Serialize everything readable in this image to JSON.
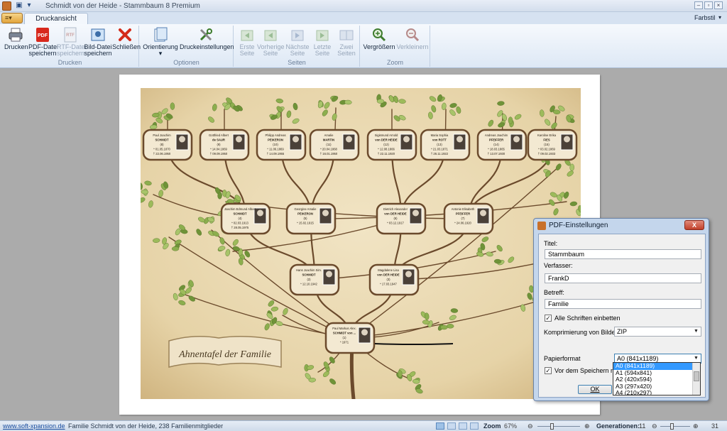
{
  "window": {
    "title": "Schmidt von der Heide - Stammbaum 8 Premium",
    "theme_label": "Farbstil"
  },
  "tabs": {
    "active": "Druckansicht"
  },
  "ribbon": {
    "groups": {
      "druck": "Drucken",
      "optionen": "Optionen",
      "seiten": "Seiten",
      "zoom": "Zoom"
    },
    "buttons": {
      "print": [
        "Drucken",
        ""
      ],
      "pdf": [
        "PDF-Datei",
        "speichern"
      ],
      "rtf": [
        "RTF-Datei",
        "speichern"
      ],
      "image": [
        "Bild-Datei",
        "speichern"
      ],
      "close": [
        "Schließen",
        ""
      ],
      "orientation": [
        "Orientierung",
        ""
      ],
      "print_settings": [
        "Druckeinstellungen",
        ""
      ],
      "first": [
        "Erste",
        "Seite"
      ],
      "prev": [
        "Vorherige",
        "Seite"
      ],
      "next": [
        "Nächste",
        "Seite"
      ],
      "last": [
        "Letzte",
        "Seite"
      ],
      "two": [
        "Zwei",
        "Seiten"
      ],
      "zoom_in": [
        "Vergrößern",
        ""
      ],
      "zoom_out": [
        "Verkleinern",
        ""
      ]
    }
  },
  "tree": {
    "banner": "Ahnentafel der Familie",
    "people": [
      [
        "Paul Joachim",
        "SCHMIDT",
        "(8)",
        "* 01.05.1870",
        "† 22.06.1950"
      ],
      [
        "Gottfried Albert",
        "de SAUR",
        "(9)",
        "* 14.04.1869",
        "† 09.09.1950"
      ],
      [
        "Philipp Andreas",
        "PEIKERON",
        "(10)",
        "* 11.06.1869",
        "† 14.09.1955"
      ],
      [
        "Amalie",
        "MARTIN",
        "(11)",
        "* 20.04.1868",
        "† 16.01.1950"
      ],
      [
        "Sigismund Arnold",
        "von DER HEIDE",
        "(12)",
        "* 12.08.1866",
        "† 22.11.1920"
      ],
      [
        "Maria Sophia",
        "von ROTT",
        "(13)",
        "* 21.03.1871",
        "† 26.11.1922"
      ],
      [
        "Andreas Joachim",
        "PFEIFFER",
        "(14)",
        "* 18.03.1865",
        "† 13.07.1930"
      ],
      [
        "Karoline Erika",
        "FIES",
        "(15)",
        "* 03.02.1869",
        "† 09.02.1933"
      ],
      [
        "Joachim Edmund Albert",
        "SCHMIDT",
        "(4)",
        "* 02.03.1913",
        "† 28.05.1975"
      ],
      [
        "Georgine Amalie",
        "PEIKERON",
        "(5)",
        "* 15.02.1915",
        ""
      ],
      [
        "Dietrich Alexander",
        "von DER HEIDE",
        "(6)",
        "* 03.12.1917",
        ""
      ],
      [
        "Antonie Elisabeth",
        "PFEIFFER",
        "(7)",
        "* 24.06.1920",
        ""
      ],
      [
        "Hans Joachim Sim.",
        "SCHMIDT",
        "(2)",
        "* 12.10.1942",
        ""
      ],
      [
        "Magdalene Lisa",
        "von DER HEIDE",
        "(3)",
        "* 17.03.1947",
        ""
      ],
      [
        "Paul Markus Alex.",
        "SCHMIDT von ...",
        "(1)",
        "* 1971",
        ""
      ]
    ]
  },
  "dialog": {
    "title": "PDF-Einstellungen",
    "close": "X",
    "title_label": "Titel:",
    "title_value": "Stammbaum",
    "author_label": "Verfasser:",
    "author_value": "FrankD",
    "subject_label": "Betreff:",
    "subject_value": "Familie",
    "embed_fonts": "Alle Schriften einbetten",
    "compression_label": "Komprimierung von Bildern",
    "compression_value": "ZIP",
    "paper_label": "Papierformat",
    "paper_value": "A0 (841x1189)",
    "paper_options": [
      "A0 (841x1189)",
      "A1 (594x841)",
      "A2 (420x594)",
      "A3 (297x420)",
      "A4 (210x297)"
    ],
    "save_note": "Vor dem Speichern nach d",
    "ok": "OK"
  },
  "status": {
    "link": "www.soft-xpansion.de",
    "info": "Familie Schmidt von der Heide, 238 Familienmitglieder",
    "zoom_label": "Zoom",
    "zoom_value": "67%",
    "gen_label": "Generationen:",
    "gen_value": "11",
    "gen_max": "31"
  },
  "colors": {
    "accent": "#3399ff",
    "ribbon": "#dde8f5",
    "parchment": "#e6d3a7",
    "branch": "#6b4a2c",
    "leaf": "#8cae4e"
  }
}
